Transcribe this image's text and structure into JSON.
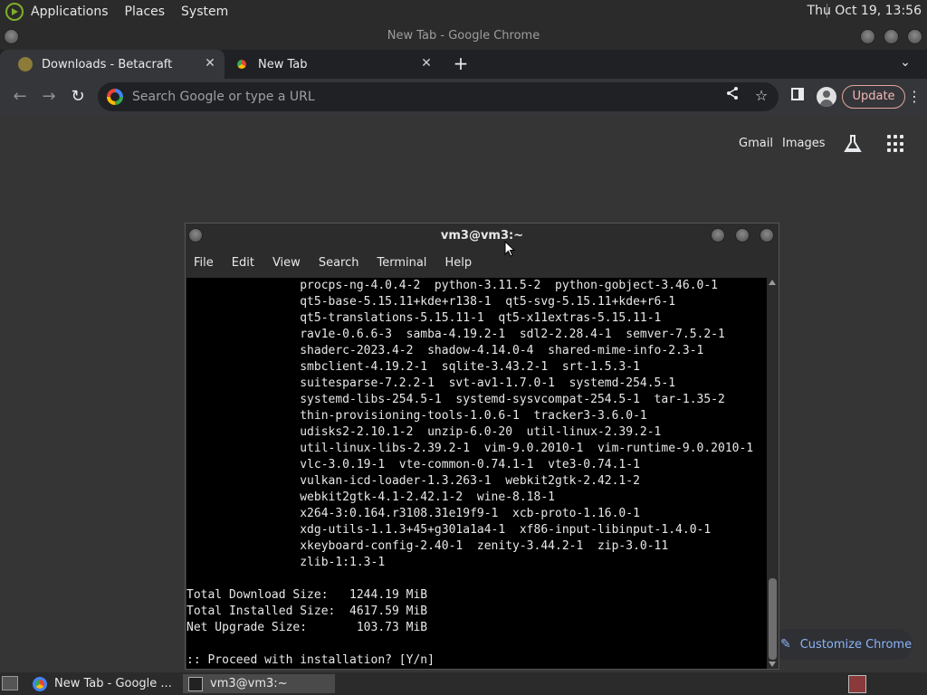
{
  "top_panel": {
    "menus": [
      "Applications",
      "Places",
      "System"
    ],
    "clock": "Thu Oct 19, 13:56"
  },
  "chrome": {
    "window_title": "New Tab - Google Chrome",
    "tabs": [
      {
        "label": "Downloads - Betacraft",
        "close": "✕"
      },
      {
        "label": "New Tab",
        "close": "✕"
      }
    ],
    "new_tab": "+",
    "tab_list": "⌄",
    "omnibox_placeholder": "Search Google or type a URL",
    "update_label": "Update",
    "ntp": {
      "links": [
        "Gmail",
        "Images"
      ],
      "customize_label": "Customize Chrome"
    }
  },
  "terminal": {
    "title": "vm3@vm3:~",
    "menu": [
      "File",
      "Edit",
      "View",
      "Search",
      "Terminal",
      "Help"
    ],
    "lines": [
      "                procps-ng-4.0.4-2  python-3.11.5-2  python-gobject-3.46.0-1",
      "                qt5-base-5.15.11+kde+r138-1  qt5-svg-5.15.11+kde+r6-1",
      "                qt5-translations-5.15.11-1  qt5-x11extras-5.15.11-1",
      "                rav1e-0.6.6-3  samba-4.19.2-1  sdl2-2.28.4-1  semver-7.5.2-1",
      "                shaderc-2023.4-2  shadow-4.14.0-4  shared-mime-info-2.3-1",
      "                smbclient-4.19.2-1  sqlite-3.43.2-1  srt-1.5.3-1",
      "                suitesparse-7.2.2-1  svt-av1-1.7.0-1  systemd-254.5-1",
      "                systemd-libs-254.5-1  systemd-sysvcompat-254.5-1  tar-1.35-2",
      "                thin-provisioning-tools-1.0.6-1  tracker3-3.6.0-1",
      "                udisks2-2.10.1-2  unzip-6.0-20  util-linux-2.39.2-1",
      "                util-linux-libs-2.39.2-1  vim-9.0.2010-1  vim-runtime-9.0.2010-1",
      "                vlc-3.0.19-1  vte-common-0.74.1-1  vte3-0.74.1-1",
      "                vulkan-icd-loader-1.3.263-1  webkit2gtk-2.42.1-2",
      "                webkit2gtk-4.1-2.42.1-2  wine-8.18-1",
      "                x264-3:0.164.r3108.31e19f9-1  xcb-proto-1.16.0-1",
      "                xdg-utils-1.1.3+45+g301a1a4-1  xf86-input-libinput-1.4.0-1",
      "                xkeyboard-config-2.40-1  zenity-3.44.2-1  zip-3.0-11",
      "                zlib-1:1.3-1",
      "",
      "Total Download Size:   1244.19 MiB",
      "Total Installed Size:  4617.59 MiB",
      "Net Upgrade Size:       103.73 MiB",
      "",
      ":: Proceed with installation? [Y/n]"
    ]
  },
  "taskbar": {
    "tasks": [
      {
        "label": "New Tab - Google ..."
      },
      {
        "label": "vm3@vm3:~"
      }
    ]
  }
}
